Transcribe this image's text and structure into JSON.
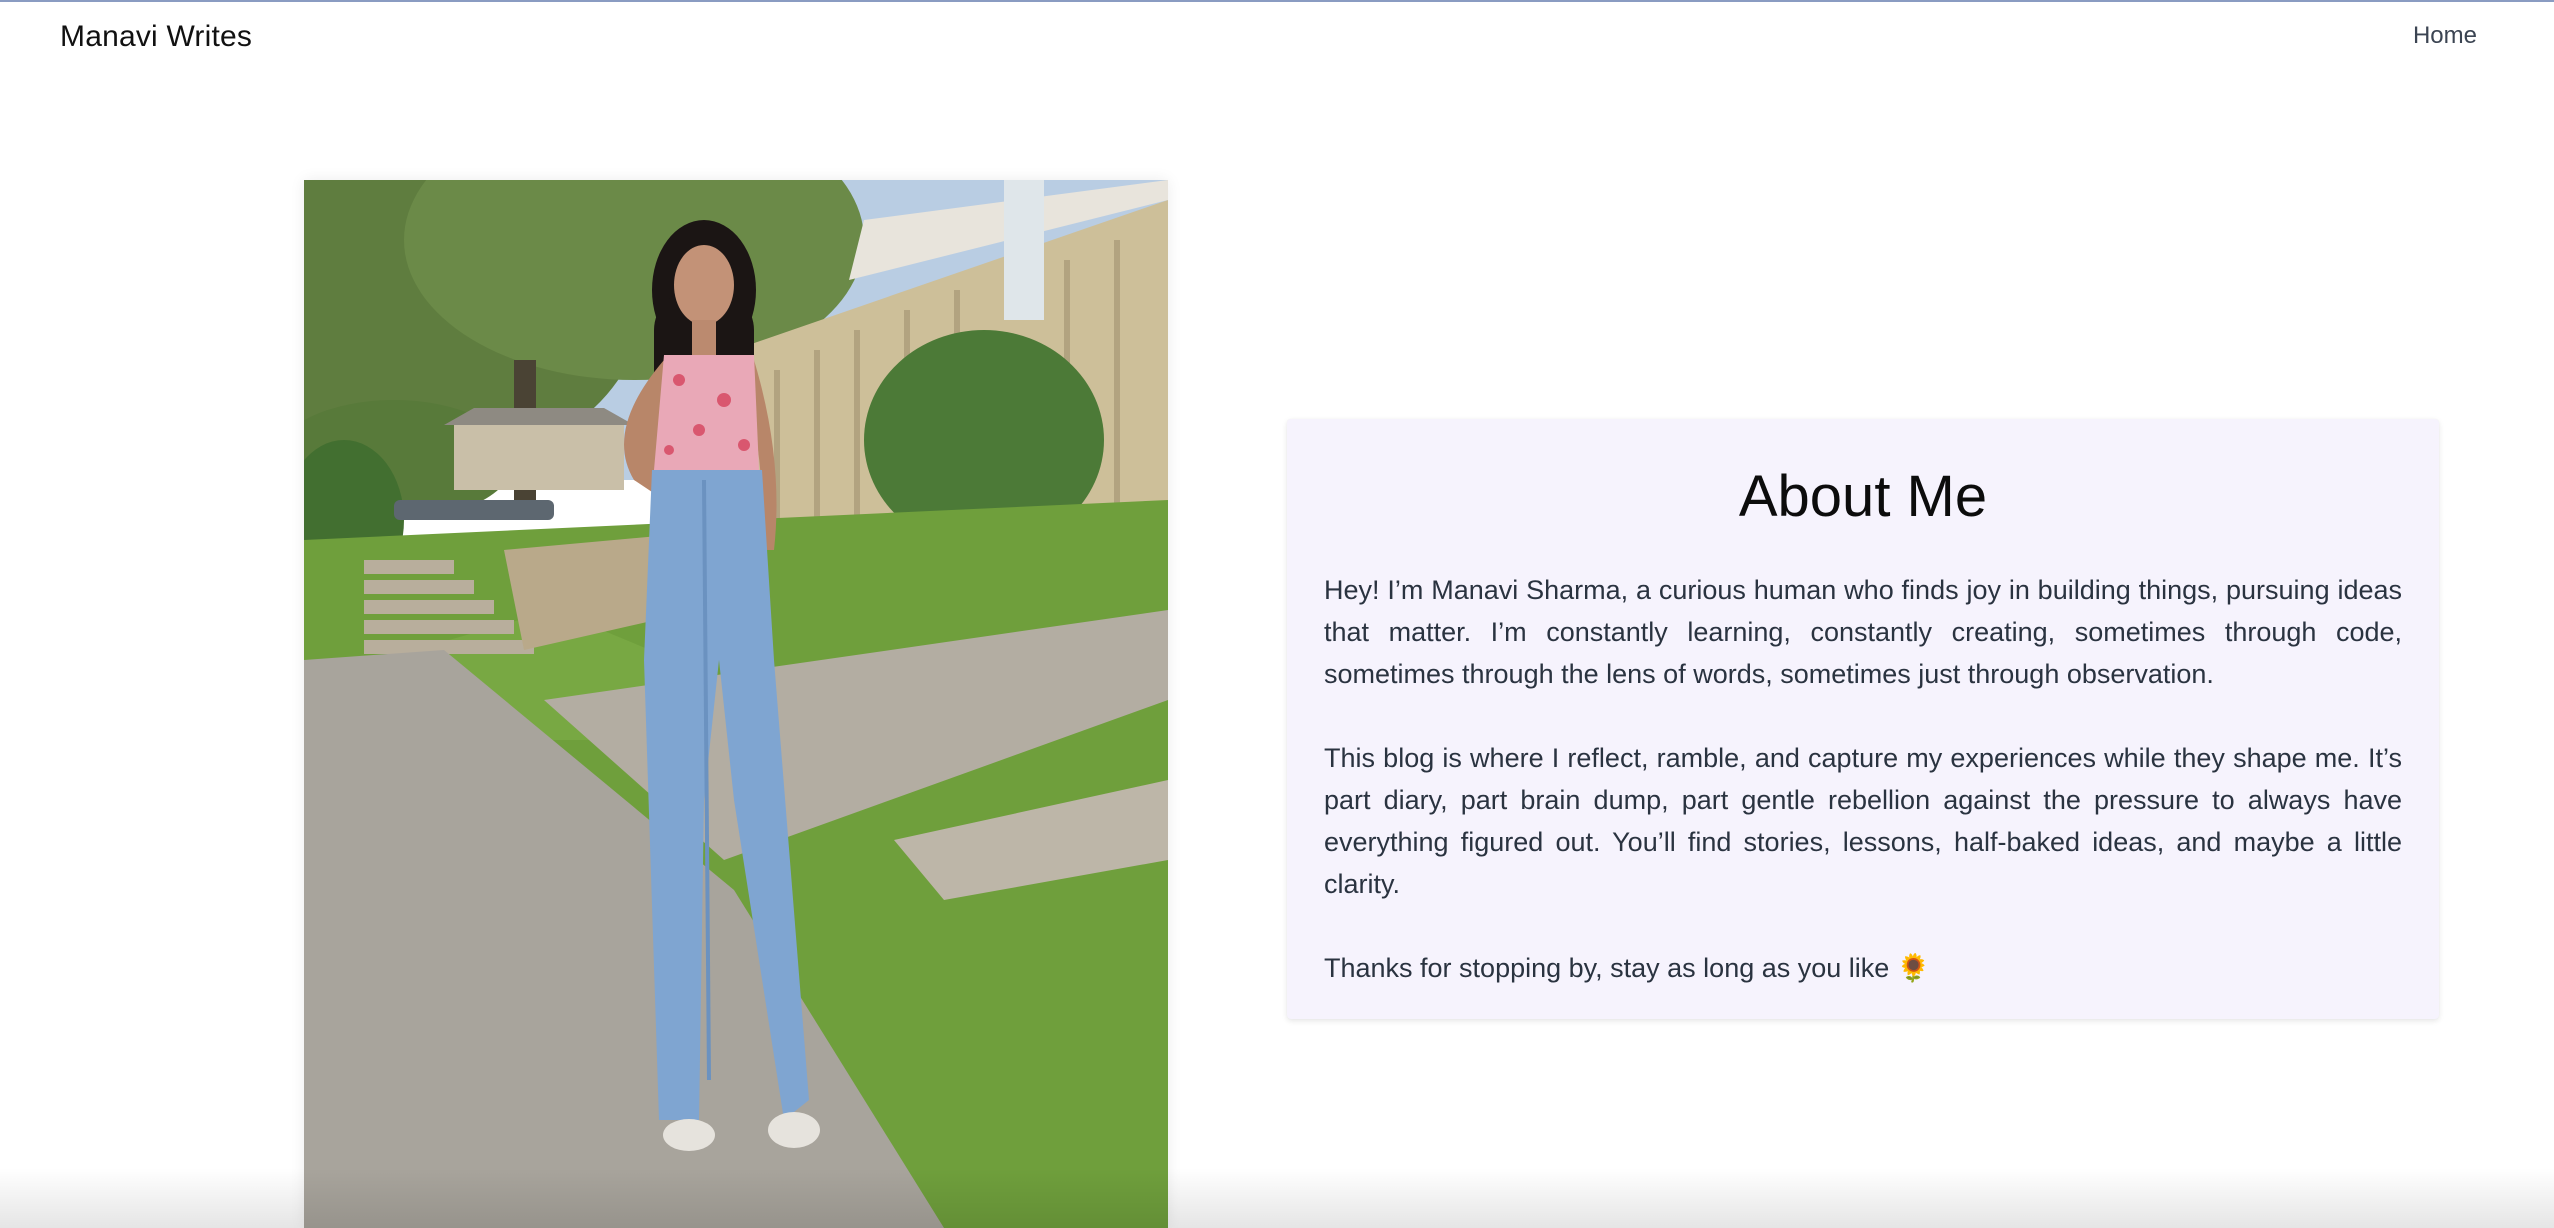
{
  "header": {
    "brand": "Manavi Writes",
    "nav": {
      "home_label": "Home"
    }
  },
  "main": {
    "photo_alt": "Manavi standing on a sidewalk outdoors",
    "about": {
      "title": "About Me",
      "paragraphs": [
        "Hey! I’m Manavi Sharma, a curious human who finds joy in building things, pursuing ideas that matter. I’m constantly learning, constantly creating, sometimes through code, sometimes through the lens of words, sometimes just through observation.",
        "This blog is where I reflect, ramble, and capture my experiences while they shape me. It’s part diary, part brain dump, part gentle rebellion against the pressure to always have everything figured out. You’ll find stories, lessons, half-baked ideas, and maybe a little clarity.",
        "Thanks for stopping by, stay as long as you like 🌻"
      ]
    }
  },
  "colors": {
    "card_background": "#f6f3fd",
    "top_rule": "#8a9cc2"
  }
}
